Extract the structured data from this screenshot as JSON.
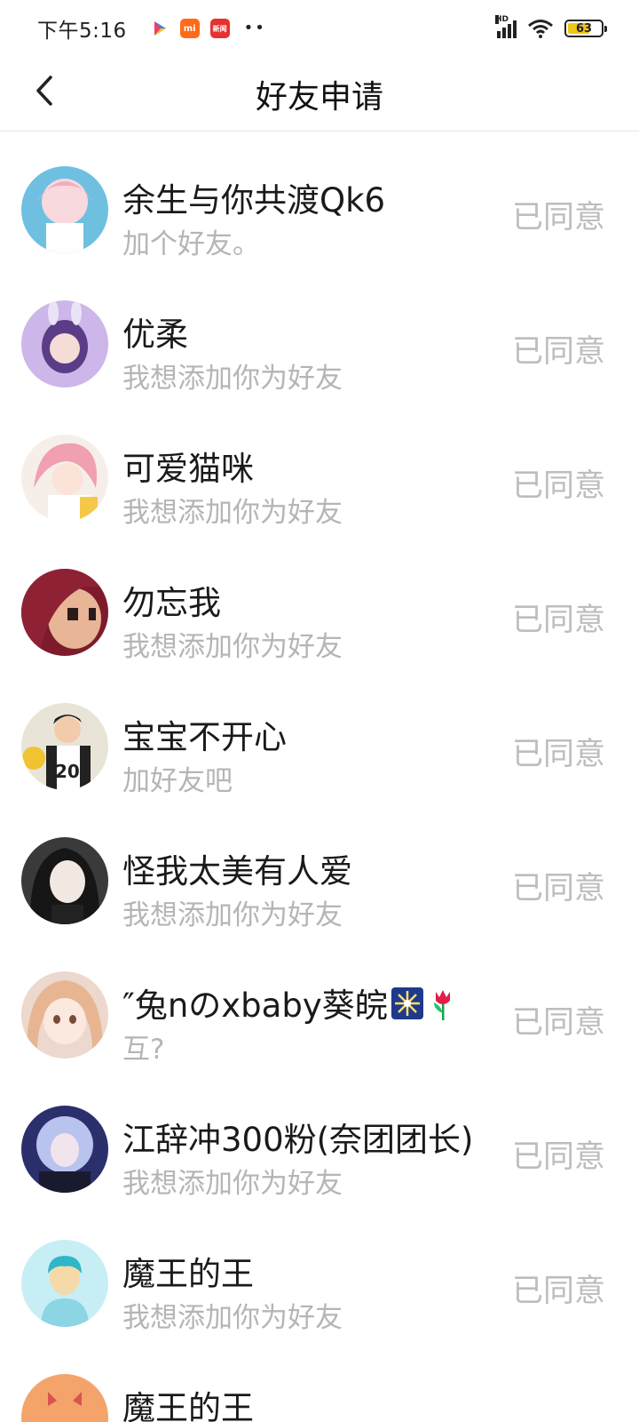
{
  "status_bar": {
    "time": "下午5:16",
    "apps": [
      {
        "icon": "play-store-icon"
      },
      {
        "icon": "mi-icon",
        "text": "mi"
      },
      {
        "icon": "news-app-icon",
        "text": "新闻"
      }
    ],
    "dots": "••",
    "signal_label": "HD",
    "battery": "63"
  },
  "header": {
    "title": "好友申请"
  },
  "requests": [
    {
      "name": "余生与你共渡Qk6",
      "message": "加个好友。",
      "status": "已同意",
      "avatar_bg": "#7ec8e3"
    },
    {
      "name": "优柔",
      "message": "我想添加你为好友",
      "status": "已同意",
      "avatar_bg": "#c9b2e6"
    },
    {
      "name": "可爱猫咪",
      "message": "我想添加你为好友",
      "status": "已同意",
      "avatar_bg": "#f2c6c8"
    },
    {
      "name": "勿忘我",
      "message": "我想添加你为好友",
      "status": "已同意",
      "avatar_bg": "#8b1e2e"
    },
    {
      "name": "宝宝不开心",
      "message": "加好友吧",
      "status": "已同意",
      "avatar_bg": "#e8e1d2"
    },
    {
      "name": "怪我太美有人爱",
      "message": "我想添加你为好友",
      "status": "已同意",
      "avatar_bg": "#2a2a2a"
    },
    {
      "name": "″兔nのxbaby葵皖",
      "message": "互?",
      "status": "已同意",
      "avatar_bg": "#e9c9b4",
      "emojis": [
        "firework-emoji",
        "tulip-emoji"
      ]
    },
    {
      "name": "江辞冲300粉(奈团团长)",
      "message": "我想添加你为好友",
      "status": "已同意",
      "avatar_bg": "#4a3f86"
    },
    {
      "name": "魔王的王",
      "message": "我想添加你为好友",
      "status": "已同意",
      "avatar_bg": "#c6edf4"
    },
    {
      "name": "魔王的王",
      "message": "",
      "status": "",
      "avatar_bg": "#f4a46b"
    }
  ]
}
